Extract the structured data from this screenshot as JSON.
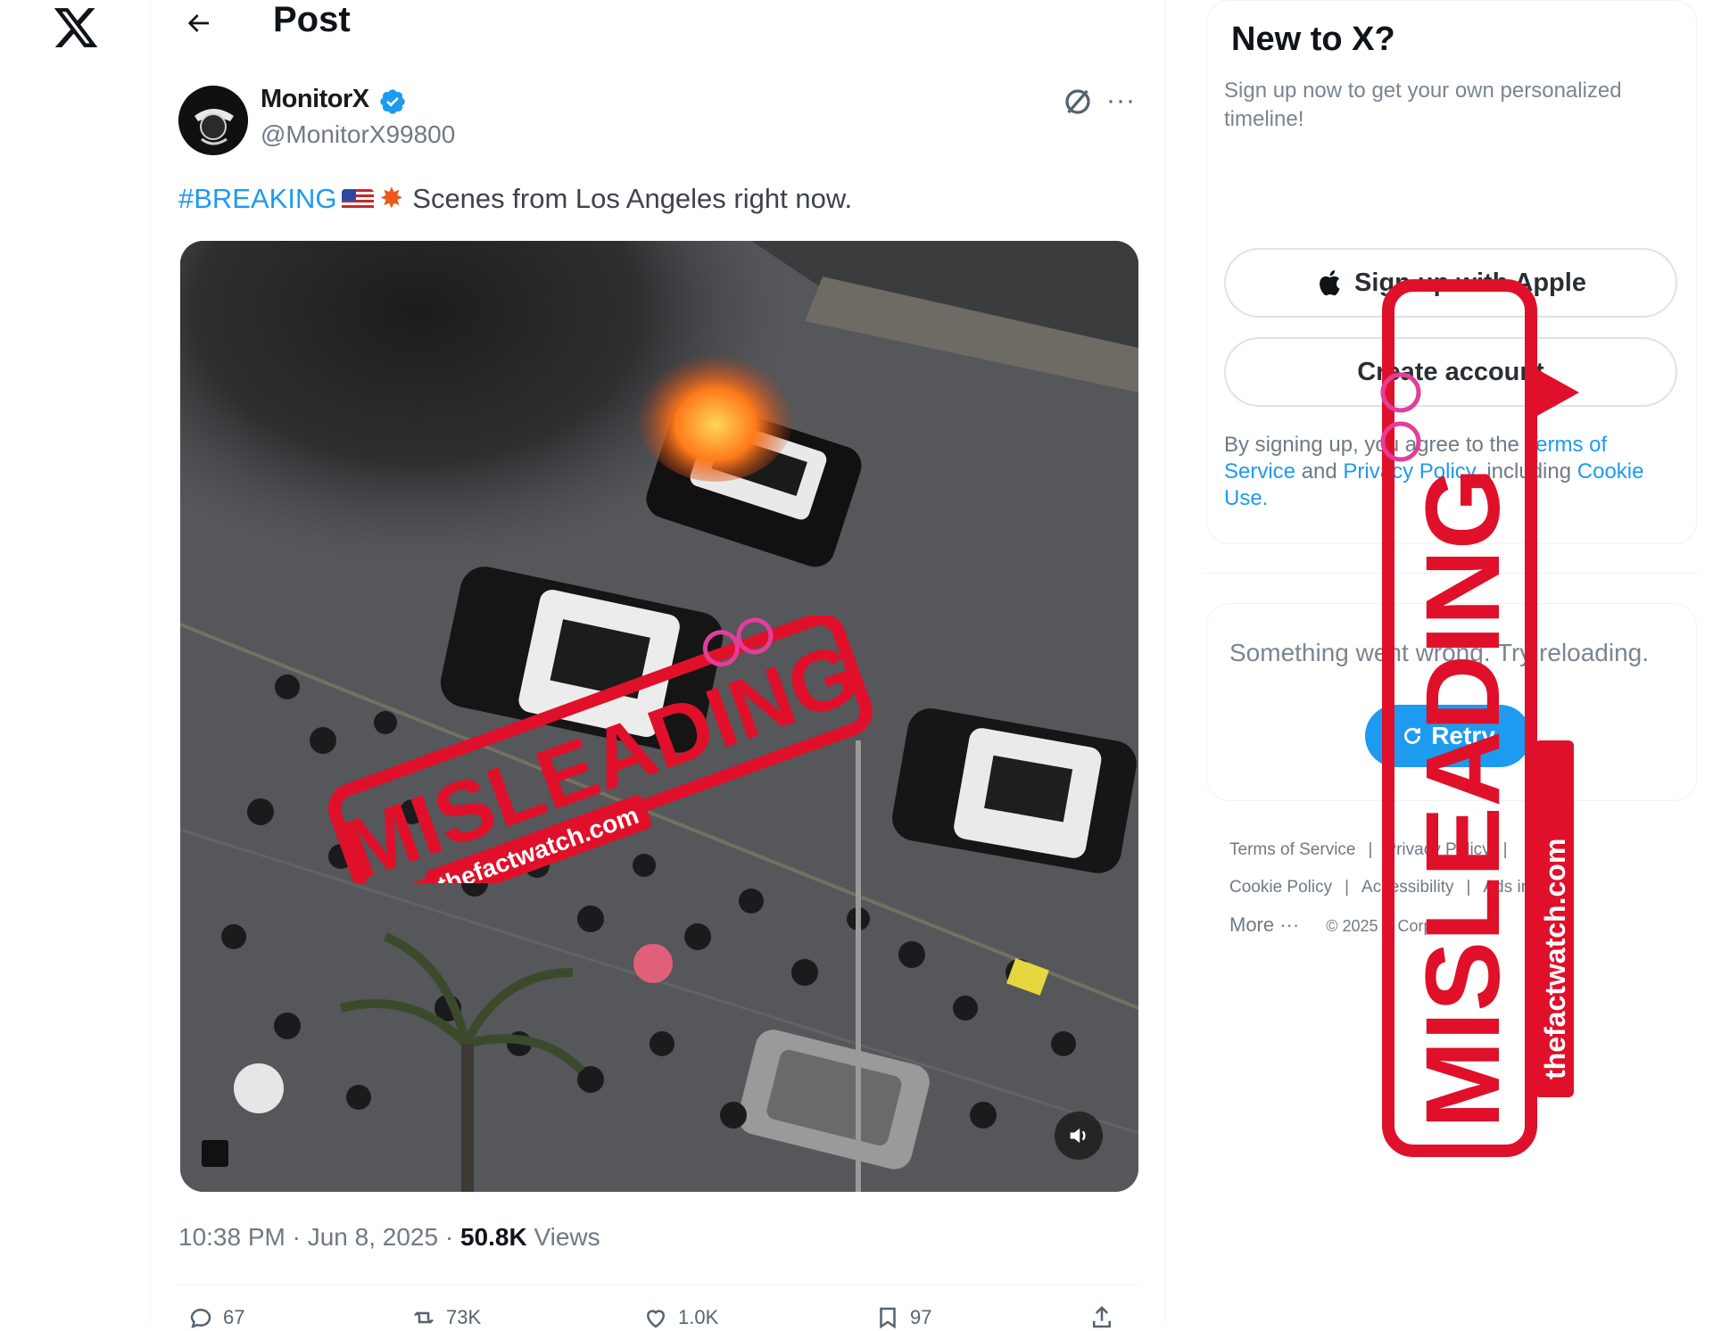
{
  "header": {
    "title": "Post"
  },
  "tweet": {
    "author_name": "MonitorX",
    "author_handle": "@MonitorX99800",
    "hashtag": "#BREAKING",
    "text": "Scenes from Los Angeles right now.",
    "time": "10:38 PM · Jun 8, 2025 · ",
    "views_count": "50.8K",
    "views_label": " Views",
    "actions": {
      "replies": "67",
      "reposts": "73K",
      "likes": "1.0K",
      "bookmarks": "97"
    }
  },
  "sidebar": {
    "new_to_x_title": "New to X?",
    "new_to_x_sub": "Sign up now to get your own personalized timeline!",
    "apple_button": "Sign up with Apple",
    "create_button": "Create account",
    "legal_prefix": "By signing up, you agree to the ",
    "terms_link": "Terms of Service",
    "and": " and ",
    "privacy_link": "Privacy Policy",
    "including": ", including ",
    "cookie_link": "Cookie Use.",
    "error_text": "Something went wrong. Try reloading.",
    "retry_button": "Retry",
    "footer": {
      "terms": "Terms of Service",
      "privacy": "Privacy Policy",
      "cookie": "Cookie Policy",
      "accessibility": "Accessibility",
      "ads_info": "Ads info",
      "more": "More ···",
      "copyright": "© 2025 X Corp."
    }
  },
  "stamps": {
    "label": "MISLEADING",
    "site": "thefactwatch.com",
    "color": "#e0102a"
  },
  "colors": {
    "accent": "#1d9bf0",
    "text": "#0f1419",
    "muted": "#536471"
  }
}
